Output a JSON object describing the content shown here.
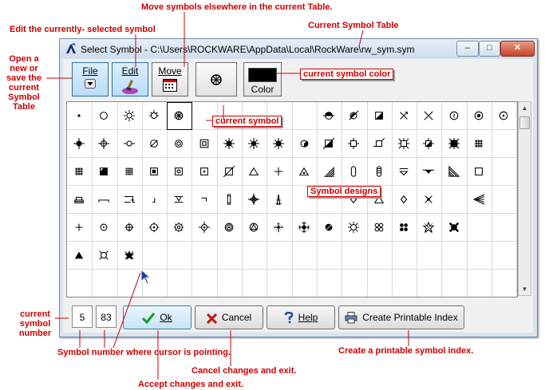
{
  "window": {
    "title": "Select Symbol - C:\\Users\\ROCKWARE\\AppData\\Local\\RockWare\\rw_sym.sym",
    "minimize": "‒",
    "maximize": "□",
    "close": "✕"
  },
  "toolbar": {
    "file_label": "File",
    "edit_label": "Edit",
    "move_label": "Move",
    "color_label": "Color",
    "color_value": "#000000"
  },
  "status": {
    "current_symbol_number": "5",
    "pointer_symbol_number": "83"
  },
  "buttons": {
    "ok": "Ok",
    "cancel": "Cancel",
    "help": "Help",
    "printable": "Create Printable Index"
  },
  "annotations": {
    "move": "Move symbols elsewhere in the current Table.",
    "edit": "Edit the currently- selected symbol",
    "table": "Current Symbol Table",
    "file_l1": "Open a",
    "file_l2": "new or",
    "file_l3": "save the",
    "file_l4": "current",
    "file_l5": "Symbol",
    "file_l6": "Table",
    "color": "current symbol color",
    "current": "current symbol",
    "designs": "Symbol designs",
    "num_l1": "current",
    "num_l2": "symbol",
    "num_l3": "number",
    "pointing": "Symbol number where  cursor is pointing.",
    "accept": "Accept changes and exit.",
    "cancel": "Cancel changes and exit.",
    "printable": "Create a printable symbol index."
  },
  "colors": {
    "annotation": "#cc0000",
    "window_frame": "#d9e4f1",
    "selected_button": "#b9ddf7"
  }
}
